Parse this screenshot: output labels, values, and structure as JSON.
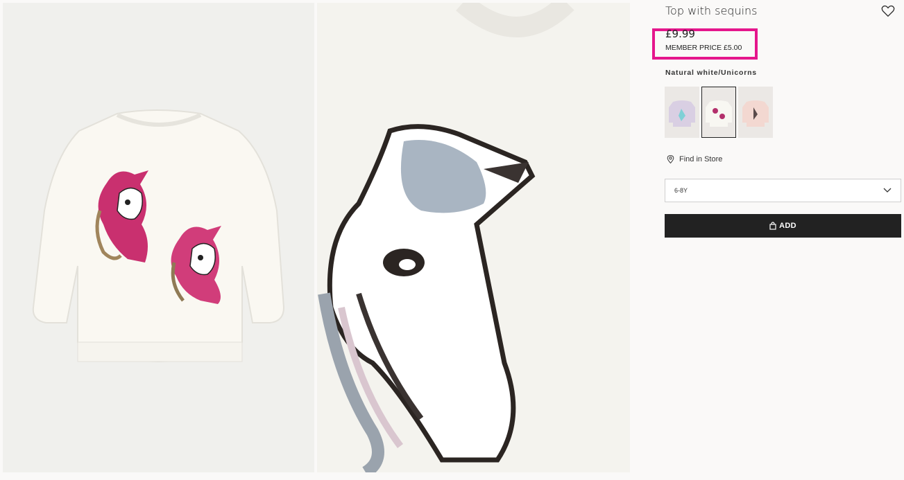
{
  "product": {
    "title": "Top with sequins",
    "price": "£9.99",
    "member_price": "MEMBER PRICE £5.00",
    "color_name": "Natural white/Unicorns",
    "highlight_color": "#e5168c"
  },
  "swatches": [
    {
      "name": "Light purple",
      "color": "#d9cfe3",
      "selected": false
    },
    {
      "name": "Natural white/Unicorns",
      "color": "#f1f0ec",
      "selected": true
    },
    {
      "name": "Light pink",
      "color": "#f3d8d1",
      "selected": false
    }
  ],
  "actions": {
    "find_in_store": "Find in Store",
    "size_value": "6-8Y",
    "add_label": "ADD"
  },
  "icons": {
    "wishlist": "heart-icon",
    "store": "location-pin-icon",
    "dropdown": "chevron-down-icon",
    "bag": "shopping-bag-icon"
  }
}
